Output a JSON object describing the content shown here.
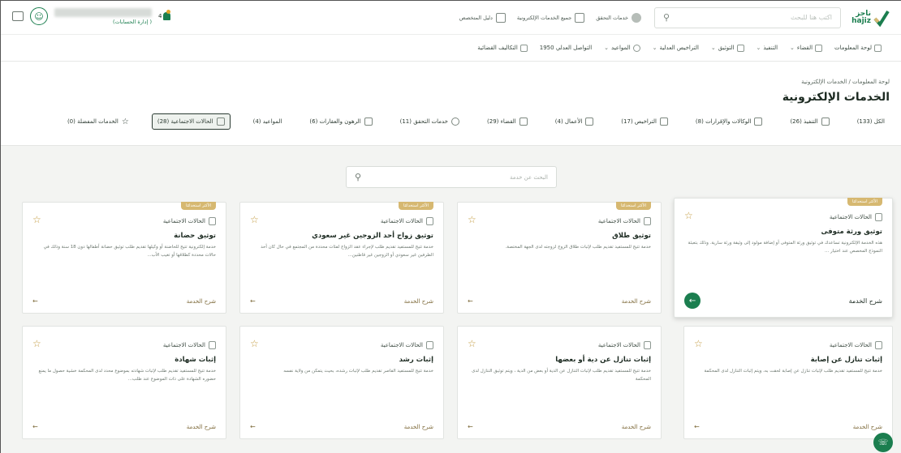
{
  "top": {
    "logo_text": "ناجز\nhajiz",
    "search_placeholder": "اكتب هنا للبحث",
    "links": [
      {
        "label": "خدمات التحقق",
        "icon": "verify-icon"
      },
      {
        "label": "جميع الخدمات الإلكترونية",
        "icon": "grid-icon"
      },
      {
        "label": "دليل المتخصص",
        "icon": "guide-icon"
      }
    ],
    "user_sub": "(إدارة الحسابات )",
    "notification_count": "4"
  },
  "nav": [
    {
      "label": "لوحة المعلومات",
      "has_chevron": false
    },
    {
      "label": "القضاء",
      "has_chevron": true
    },
    {
      "label": "التنفيذ",
      "has_chevron": true
    },
    {
      "label": "التوثيق",
      "has_chevron": true
    },
    {
      "label": "التراخيص العدلية",
      "has_chevron": true
    },
    {
      "label": "المواعيد",
      "has_chevron": true
    },
    {
      "label": "التواصل العدلي 1950",
      "has_chevron": false
    },
    {
      "label": "التكاليف القضائية",
      "has_chevron": false
    }
  ],
  "breadcrumb": "لوحة المعلومات / الخدمات الإلكترونية",
  "page_title": "الخدمات الإلكترونية",
  "tabs": [
    {
      "label": "الكل (133)",
      "active": false
    },
    {
      "label": "التنفيذ (26)",
      "active": false
    },
    {
      "label": "الوكالات والإقرارات (8)",
      "active": false
    },
    {
      "label": "التراخيص (17)",
      "active": false
    },
    {
      "label": "الأعمال (4)",
      "active": false
    },
    {
      "label": "القضاء (29)",
      "active": false
    },
    {
      "label": "خدمات التحقق (11)",
      "active": false
    },
    {
      "label": "الرهون والعقارات (6)",
      "active": false
    },
    {
      "label": "المواعيد (4)",
      "active": false
    },
    {
      "label": "الحالات الاجتماعية (28)",
      "active": true
    },
    {
      "label": "الخدمات المفضلة (0)",
      "active": false
    }
  ],
  "content_search_placeholder": "البحث عن خدمة",
  "cards": [
    {
      "badge": "الأكثر استخدامًا",
      "category": "الحالات الاجتماعية",
      "title": "توثيق ورثة متوفى",
      "desc": "هذه الخدمة الإلكترونية تساعدك في توثيق ورثة المتوفى أو إضافة مولود إلى وثيقة ورثة سارية. وذلك بتعبئة النموذج المخصص عند اختيار ...",
      "link": "شرح الخدمة",
      "highlight": true
    },
    {
      "badge": "الأكثر استخدامًا",
      "category": "الحالات الاجتماعية",
      "title": "توثيق طلاق",
      "desc": "خدمة تتيح للمستفيد تقديم طلب لإثبات طلاق الزوج لزوجته لدى الجهة المختصة.",
      "link": "شرح الخدمة",
      "highlight": false
    },
    {
      "badge": "الأكثر استخدامًا",
      "category": "الحالات الاجتماعية",
      "title": "توثيق زواج أحد الزوجين غير سعودي",
      "desc": "خدمة تتيح للمستفيد تقديم طلب لإجراء عقد الزواج لفئات محددة من المجتمع في حال كان أحد الطرفين غير سعودي أو الزوجين غير قاطنين...",
      "link": "شرح الخدمة",
      "highlight": false
    },
    {
      "badge": "الأكثر استخدامًا",
      "category": "الحالات الاجتماعية",
      "title": "توثيق حضانة",
      "desc": "خدمة إلكترونية تتيح للحاضنة أو وكيلها تقديم طلب توثيق حضانة أطفالها دون 18 سنة وذلك في حالات محددة كطلاقها أو تغيب الأب...",
      "link": "شرح الخدمة",
      "highlight": false
    },
    {
      "badge": "",
      "category": "الحالات الاجتماعية",
      "title": "إثبات تنازل عن إصابة",
      "desc": "خدمة تتيح للمستفيد تقديم طلب لإثبات تنازل عن إصابة لحقت به، ويتم إثبات التنازل لدى المحكمة",
      "link": "شرح الخدمة",
      "highlight": false
    },
    {
      "badge": "",
      "category": "الحالات الاجتماعية",
      "title": "إثبات تنازل عن دية أو بعضها",
      "desc": "خدمة تتيح للمستفيد تقديم طلب لإثبات التنازل عن الدية أو بعض من الدية ، ويتم توثيق التنازل لدى المحكمة",
      "link": "شرح الخدمة",
      "highlight": false
    },
    {
      "badge": "",
      "category": "الحالات الاجتماعية",
      "title": "إثبات رشد",
      "desc": "خدمة تتيح للمستفيد القاصر تقديم طلب لإثبات رشده، بحيث يتمكن من ولاية نفسه",
      "link": "شرح الخدمة",
      "highlight": false
    },
    {
      "badge": "",
      "category": "الحالات الاجتماعية",
      "title": "إثبات شهادة",
      "desc": "خدمة تتيح للمستفيد تقديم طلب لإثبات شهادته بموضوع محدد لدى المحكمة خشية حصول ما يمنع حضوره الشهادة على ذات الموضوع عند طلب...",
      "link": "شرح الخدمة",
      "highlight": false
    }
  ]
}
